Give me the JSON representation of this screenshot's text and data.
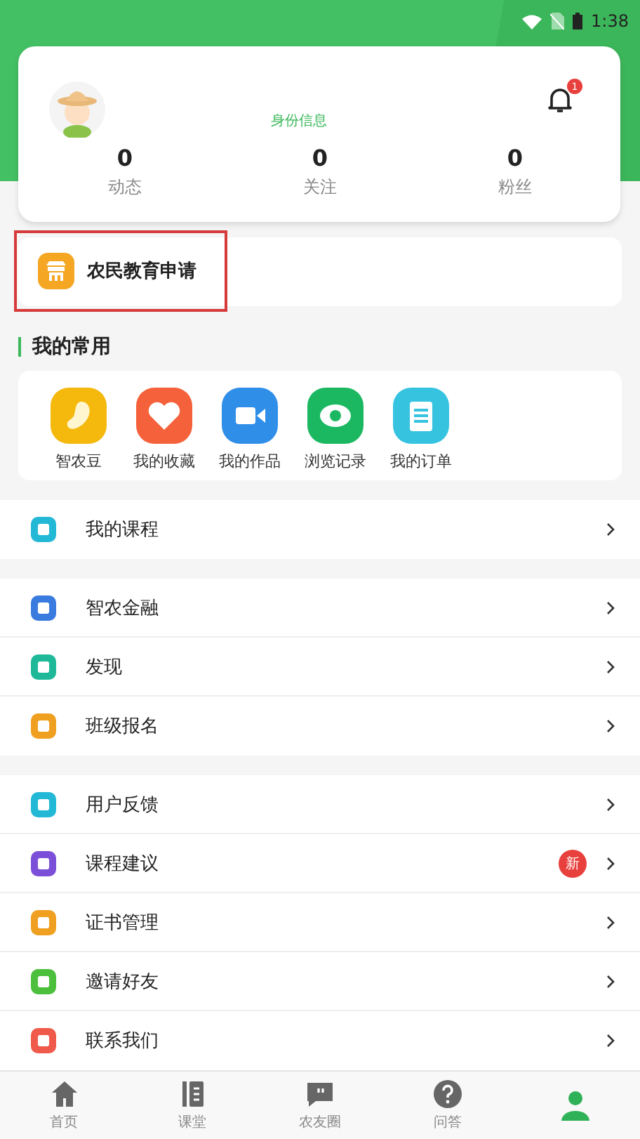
{
  "status_bar": {
    "time": "1:38"
  },
  "profile": {
    "identity_link": "身份信息",
    "notification_count": "1",
    "stats": [
      {
        "value": "0",
        "label": "动态"
      },
      {
        "value": "0",
        "label": "关注"
      },
      {
        "value": "0",
        "label": "粉丝"
      }
    ]
  },
  "apply_card": {
    "label": "农民教育申请",
    "highlighted": true
  },
  "favorites": {
    "title": "我的常用",
    "items": [
      {
        "label": "智农豆",
        "color": "#f5b80c"
      },
      {
        "label": "我的收藏",
        "color": "#f4613a"
      },
      {
        "label": "我的作品",
        "color": "#2f8ee8"
      },
      {
        "label": "浏览记录",
        "color": "#1cb861"
      },
      {
        "label": "我的订单",
        "color": "#35c3e0"
      }
    ]
  },
  "menu_groups": [
    [
      {
        "label": "我的课程",
        "color": "#22b8d6"
      }
    ],
    [
      {
        "label": "智农金融",
        "color": "#3a7be0"
      },
      {
        "label": "发现",
        "color": "#1fb99a"
      },
      {
        "label": "班级报名",
        "color": "#f0a020"
      }
    ],
    [
      {
        "label": "用户反馈",
        "color": "#22b8d6"
      },
      {
        "label": "课程建议",
        "color": "#7c4fd8",
        "badge": "新"
      },
      {
        "label": "证书管理",
        "color": "#f0a020"
      },
      {
        "label": "邀请好友",
        "color": "#4cbf3c"
      },
      {
        "label": "联系我们",
        "color": "#ef5a4a"
      }
    ]
  ],
  "bottom_nav": [
    {
      "label": "首页",
      "selected": false
    },
    {
      "label": "课堂",
      "selected": false
    },
    {
      "label": "农友圈",
      "selected": false
    },
    {
      "label": "问答",
      "selected": false
    },
    {
      "selected": true
    }
  ]
}
